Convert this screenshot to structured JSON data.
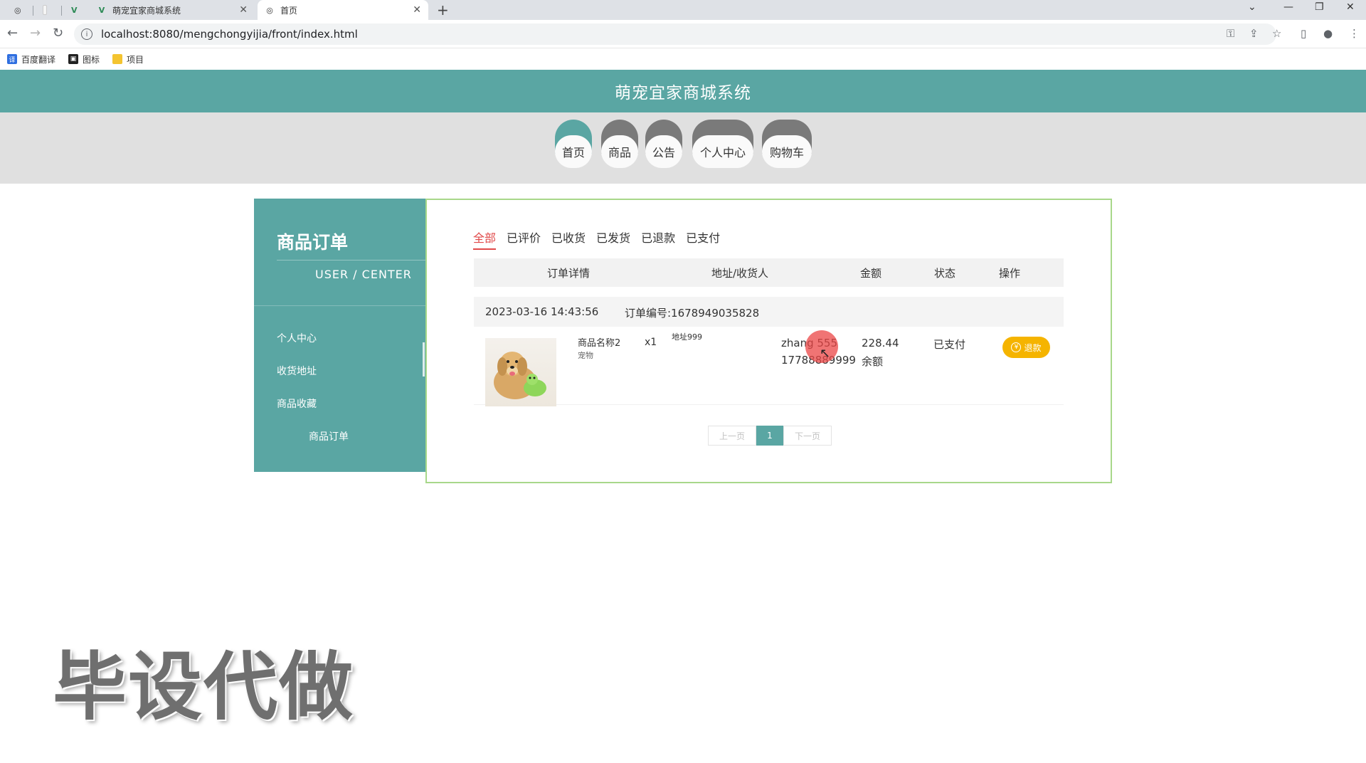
{
  "browser": {
    "tabs": [
      {
        "label": ""
      },
      {
        "label": ""
      },
      {
        "label": ""
      },
      {
        "label": "萌宠宜家商城系统"
      },
      {
        "label": "首页"
      }
    ],
    "new_tab": "+",
    "url": "localhost:8080/mengchongyijia/front/index.html",
    "bookmarks": [
      {
        "label": "百度翻译",
        "icon": "translate-icon"
      },
      {
        "label": "图标",
        "icon": "image-icon"
      },
      {
        "label": "项目",
        "icon": "folder-icon"
      }
    ]
  },
  "site": {
    "title": "萌宠宜家商城系统",
    "nav": [
      {
        "label": "首页",
        "active": true
      },
      {
        "label": "商品",
        "active": false
      },
      {
        "label": "公告",
        "active": false
      },
      {
        "label": "个人中心",
        "active": false
      },
      {
        "label": "购物车",
        "active": false
      }
    ]
  },
  "sidebar": {
    "title": "商品订单",
    "subtitle": "USER / CENTER",
    "items": [
      {
        "label": "个人中心"
      },
      {
        "label": "收货地址"
      },
      {
        "label": "商品收藏"
      },
      {
        "label": "商品订单"
      }
    ]
  },
  "orders": {
    "tabs": [
      {
        "label": "全部",
        "active": true
      },
      {
        "label": "已评价"
      },
      {
        "label": "已收货"
      },
      {
        "label": "已发货"
      },
      {
        "label": "已退款"
      },
      {
        "label": "已支付"
      }
    ],
    "columns": [
      "订单详情",
      "地址/收货人",
      "金额",
      "状态",
      "操作"
    ],
    "order": {
      "time": "2023-03-16 14:43:56",
      "number": "订单编号:1678949035828",
      "product_name": "商品名称2",
      "product_type": "宠物",
      "qty": "x1",
      "address": "地址999",
      "receiver_name": "zhang 555",
      "receiver_phone": "17788889999",
      "amount": "228.44",
      "pay_method": "余额",
      "status": "已支付",
      "action": "退款"
    },
    "pager": {
      "prev": "上一页",
      "current": "1",
      "next": "下一页"
    }
  },
  "watermark": "毕设代做",
  "colors": {
    "primary": "#5aa6a3",
    "active_tab": "#e04848",
    "refund": "#f5b400",
    "panel_border": "#a8d88a"
  }
}
